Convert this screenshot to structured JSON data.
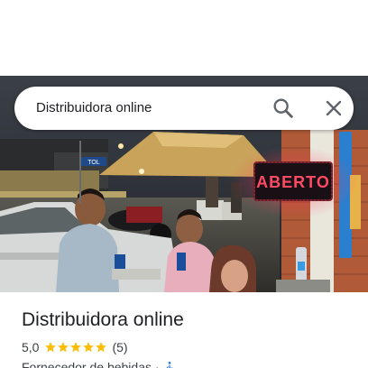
{
  "search": {
    "value": "Distribuidora online"
  },
  "photo": {
    "sign_text": "ABERTO",
    "street_sign_text": "TOL"
  },
  "place": {
    "name": "Distribuidora online",
    "rating": "5,0",
    "stars": 5,
    "reviews": "(5)",
    "category": "Fornecedor de bebidas",
    "separator": "·"
  },
  "colors": {
    "star": "#fbbc04",
    "sign_red": "#e8263a",
    "accessibility_blue": "#1a73e8"
  }
}
